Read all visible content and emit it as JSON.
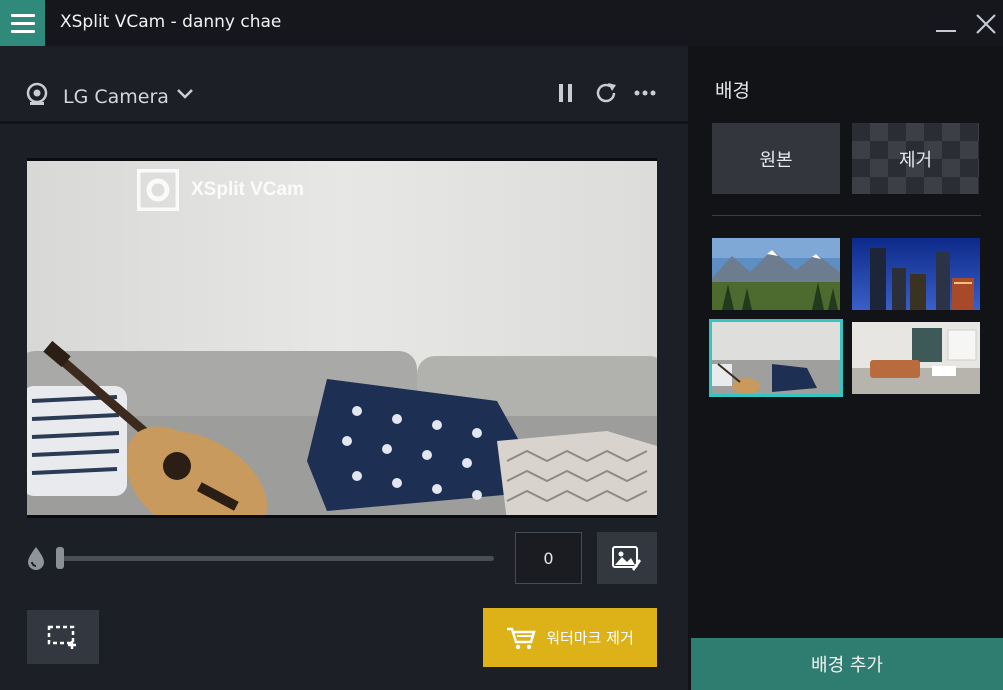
{
  "app": {
    "title": "XSplit VCam - danny chae"
  },
  "camera": {
    "name": "LG Camera"
  },
  "preview": {
    "watermark_text": "XSplit VCam"
  },
  "controls": {
    "blur_value": "0",
    "blur_level": 0,
    "watermark_remove_label": "워터마크 제거"
  },
  "background": {
    "heading": "배경",
    "original_label": "원본",
    "remove_label": "제거",
    "thumbnails": [
      "mountain-landscape",
      "city-skyline-night",
      "living-room-guitar",
      "modern-apartment"
    ],
    "selected_index": 2,
    "add_label": "배경 추가"
  },
  "colors": {
    "accent_teal": "#2f8a7c",
    "selection": "#35c5c0",
    "watermark_button": "#ddb118",
    "add_button": "#2f7d71"
  },
  "icons": [
    "hamburger-icon",
    "minimize-icon",
    "close-icon",
    "webcam-icon",
    "chevron-down-icon",
    "pause-icon",
    "refresh-icon",
    "more-icon",
    "blur-drop-icon",
    "image-edit-icon",
    "crop-add-icon",
    "cart-icon"
  ]
}
